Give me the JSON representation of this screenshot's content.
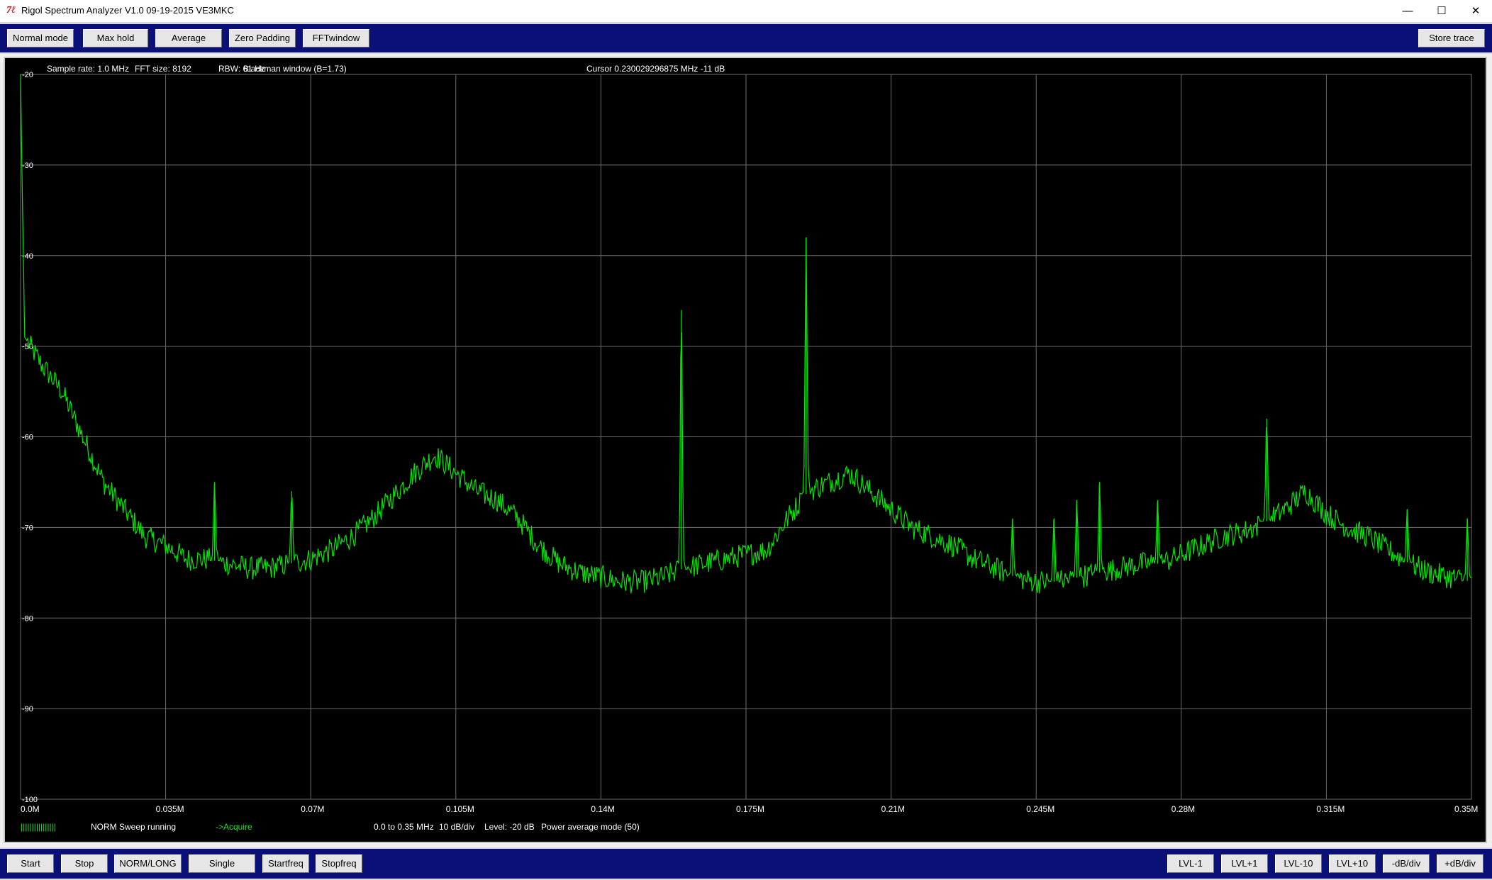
{
  "window": {
    "title": "Rigol Spectrum Analyzer V1.0 09-19-2015 VE3MKC",
    "icon": "rigol-logo-icon",
    "minimize_glyph": "—",
    "maximize_glyph": "☐",
    "close_glyph": "✕"
  },
  "top_toolbar": {
    "normal_mode": "Normal mode",
    "max_hold": "Max hold",
    "average": "Average",
    "zero_padding": "Zero Padding",
    "fft_window": "FFTwindow",
    "store_trace": "Store trace"
  },
  "header_info": {
    "sample_rate": "Sample rate: 1.0 MHz",
    "fft_size": "FFT size: 8192",
    "rbw": "RBW: 61 Hz",
    "window": "Blackman window (B=1.73)",
    "cursor": "Cursor 0.230029296875 MHz   -11 dB"
  },
  "status": {
    "mode": "NORM Sweep running",
    "acquire": "->Acquire",
    "range": "0.0 to 0.35 MHz",
    "scale": "10 dB/div",
    "level": "Level: -20 dB",
    "avg_mode": "Power average  mode (50)"
  },
  "bottom_toolbar": {
    "start": "Start",
    "stop": "Stop",
    "norm_long": "NORM/LONG",
    "single": "Single",
    "startfreq": "Startfreq",
    "stopfreq": "Stopfreq",
    "lvl_minus1": "LVL-1",
    "lvl_plus1": "LVL+1",
    "lvl_minus10": "LVL-10",
    "lvl_plus10": "LVL+10",
    "db_div_minus": "-dB/div",
    "db_div_plus": "+dB/div"
  },
  "colors": {
    "trace": "#00e600",
    "grid": "#6e6e6e",
    "toolbar": "#0a1078",
    "background": "#000000"
  },
  "chart_data": {
    "type": "line",
    "x_unit": "MHz",
    "y_unit": "dB",
    "xlim": [
      0,
      0.35
    ],
    "ylim": [
      -100,
      -20
    ],
    "x_ticks": [
      "0.0M",
      "0.035M",
      "0.07M",
      "0.105M",
      "0.14M",
      "0.175M",
      "0.21M",
      "0.245M",
      "0.28M",
      "0.315M",
      "0.35M"
    ],
    "y_ticks": [
      "-20",
      "-30",
      "-40",
      "-50",
      "-60",
      "-70",
      "-80",
      "-90",
      "-100"
    ],
    "grid": true,
    "series": [
      {
        "x": [
          0.0,
          0.0003,
          0.001,
          0.005,
          0.01,
          0.015,
          0.02,
          0.025,
          0.03,
          0.035,
          0.04,
          0.045,
          0.05,
          0.055,
          0.06,
          0.065,
          0.07,
          0.075,
          0.08,
          0.085,
          0.09,
          0.095,
          0.1,
          0.105,
          0.11,
          0.115,
          0.12,
          0.125,
          0.13,
          0.135,
          0.14,
          0.145,
          0.15,
          0.155,
          0.16,
          0.165,
          0.17,
          0.175,
          0.18,
          0.185,
          0.19,
          0.195,
          0.2,
          0.205,
          0.21,
          0.215,
          0.22,
          0.225,
          0.23,
          0.235,
          0.24,
          0.245,
          0.25,
          0.255,
          0.26,
          0.265,
          0.27,
          0.275,
          0.28,
          0.285,
          0.29,
          0.295,
          0.3,
          0.305,
          0.31,
          0.315,
          0.32,
          0.325,
          0.33,
          0.335,
          0.34,
          0.345,
          0.35
        ],
        "values": [
          -20,
          -30,
          -49,
          -52,
          -55,
          -60,
          -65,
          -68,
          -71,
          -72,
          -73.5,
          -73.5,
          -74,
          -74.5,
          -74.5,
          -74,
          -73.5,
          -72.5,
          -71,
          -69,
          -66.5,
          -64,
          -62,
          -64,
          -66,
          -67,
          -69,
          -72,
          -74,
          -75,
          -75.5,
          -76,
          -76,
          -75.5,
          -74.5,
          -74,
          -73.5,
          -73,
          -72.5,
          -69,
          -66,
          -65,
          -64,
          -66,
          -68,
          -70,
          -71,
          -72,
          -73.5,
          -74.5,
          -75.5,
          -76,
          -76,
          -75.5,
          -75,
          -74.5,
          -74,
          -74,
          -73,
          -72,
          -71,
          -70.5,
          -69.5,
          -68,
          -66,
          -68.5,
          -70,
          -71,
          -72.5,
          -74,
          -75,
          -75.5,
          -76
        ]
      }
    ],
    "spurs": [
      {
        "x": 0.0468,
        "peak": -65
      },
      {
        "x": 0.0654,
        "peak": -66
      },
      {
        "x": 0.1594,
        "peak": -46
      },
      {
        "x": 0.1895,
        "peak": -38
      },
      {
        "x": 0.2393,
        "peak": -69
      },
      {
        "x": 0.2493,
        "peak": -69
      },
      {
        "x": 0.2548,
        "peak": -67
      },
      {
        "x": 0.2603,
        "peak": -65
      },
      {
        "x": 0.2743,
        "peak": -67
      },
      {
        "x": 0.3006,
        "peak": -58
      },
      {
        "x": 0.3345,
        "peak": -68
      },
      {
        "x": 0.349,
        "peak": -69
      }
    ]
  }
}
